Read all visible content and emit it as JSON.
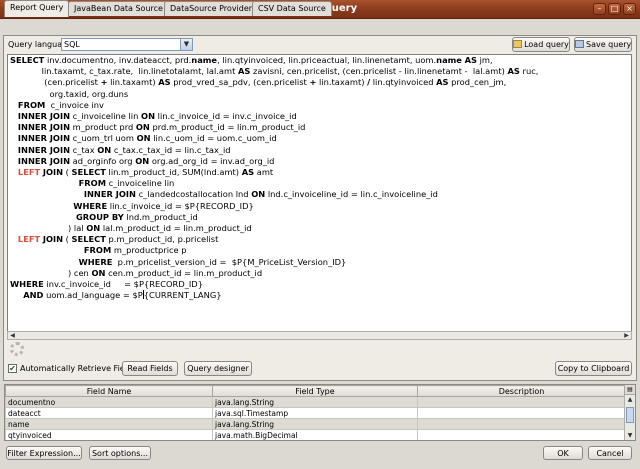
{
  "window": {
    "title": "Report query"
  },
  "tabs": [
    {
      "label": "Report Query",
      "active": true
    },
    {
      "label": "JavaBean Data Source",
      "active": false
    },
    {
      "label": "DataSource Provider",
      "active": false
    },
    {
      "label": "CSV Data Source",
      "active": false
    }
  ],
  "query": {
    "language_label": "Query language",
    "language_value": "SQL",
    "load_label": "Load query",
    "save_label": "Save query"
  },
  "sql_lines": [
    [
      [
        "k",
        "SELECT"
      ],
      [
        "t",
        " inv.documentno, inv.dateacct, prd."
      ],
      [
        "k",
        "name"
      ],
      [
        "t",
        ", lin.qtyinvoiced, lin.priceactual, lin.linenetamt, uom."
      ],
      [
        "k",
        "name"
      ],
      [
        "t",
        " "
      ],
      [
        "k",
        "AS"
      ],
      [
        "t",
        " jm,"
      ]
    ],
    [
      [
        "t",
        "            lin.taxamt, c_tax.rate,  lin.linetotalamt, lal.amt "
      ],
      [
        "k",
        "AS"
      ],
      [
        "t",
        " zavisni, cen.pricelist, (cen.pricelist - lin.linenetamt -  lal.amt) "
      ],
      [
        "k",
        "AS"
      ],
      [
        "t",
        " ruc,"
      ]
    ],
    [
      [
        "t",
        "             (cen.pricelist "
      ],
      [
        "k",
        "+"
      ],
      [
        "t",
        " lin.taxamt) "
      ],
      [
        "k",
        "AS"
      ],
      [
        "t",
        " prod_vred_sa_pdv, (cen.pricelist "
      ],
      [
        "k",
        "+"
      ],
      [
        "t",
        " lin.taxamt) "
      ],
      [
        "k",
        "/"
      ],
      [
        "t",
        " lin.qtyinvoiced "
      ],
      [
        "k",
        "AS"
      ],
      [
        "t",
        " prod_cen_jm,"
      ]
    ],
    [
      [
        "t",
        "               org.taxid, org.duns"
      ]
    ],
    [
      [
        "t",
        "   "
      ],
      [
        "k",
        "FROM"
      ],
      [
        "t",
        "  c_invoice inv"
      ]
    ],
    [
      [
        "t",
        "   "
      ],
      [
        "k",
        "INNER JOIN"
      ],
      [
        "t",
        " c_invoiceline lin "
      ],
      [
        "k",
        "ON"
      ],
      [
        "t",
        " lin.c_invoice_id = inv.c_invoice_id"
      ]
    ],
    [
      [
        "t",
        "   "
      ],
      [
        "k",
        "INNER JOIN"
      ],
      [
        "t",
        " m_product prd "
      ],
      [
        "k",
        "ON"
      ],
      [
        "t",
        " prd.m_product_id = lin.m_product_id"
      ]
    ],
    [
      [
        "t",
        "   "
      ],
      [
        "k",
        "INNER JOIN"
      ],
      [
        "t",
        " c_uom_trl uom "
      ],
      [
        "k",
        "ON"
      ],
      [
        "t",
        " lin.c_uom_id = uom.c_uom_id"
      ]
    ],
    [
      [
        "t",
        "   "
      ],
      [
        "k",
        "INNER JOIN"
      ],
      [
        "t",
        " c_tax "
      ],
      [
        "k",
        "ON"
      ],
      [
        "t",
        " c_tax.c_tax_id = lin.c_tax_id"
      ]
    ],
    [
      [
        "t",
        "   "
      ],
      [
        "k",
        "INNER JOIN"
      ],
      [
        "t",
        " ad_orginfo org "
      ],
      [
        "k",
        "ON"
      ],
      [
        "t",
        " org.ad_org_id = inv.ad_org_id"
      ]
    ],
    [
      [
        "t",
        "   "
      ],
      [
        "l",
        "LEFT"
      ],
      [
        "t",
        " "
      ],
      [
        "k",
        "JOIN"
      ],
      [
        "t",
        " ( "
      ],
      [
        "k",
        "SELECT"
      ],
      [
        "t",
        " lin.m_product_id, SUM(lnd.amt) "
      ],
      [
        "k",
        "AS"
      ],
      [
        "t",
        " amt"
      ]
    ],
    [
      [
        "t",
        "                          "
      ],
      [
        "k",
        "FROM"
      ],
      [
        "t",
        " c_invoiceline lin"
      ]
    ],
    [
      [
        "t",
        "                            "
      ],
      [
        "k",
        "INNER JOIN"
      ],
      [
        "t",
        " c_landedcostallocation lnd "
      ],
      [
        "k",
        "ON"
      ],
      [
        "t",
        " lnd.c_invoiceline_id = lin.c_invoiceline_id"
      ]
    ],
    [
      [
        "t",
        "                        "
      ],
      [
        "k",
        "WHERE"
      ],
      [
        "t",
        " lin.c_invoice_id = $P{RECORD_ID}"
      ]
    ],
    [
      [
        "t",
        "                         "
      ],
      [
        "k",
        "GROUP BY"
      ],
      [
        "t",
        " lnd.m_product_id"
      ]
    ],
    [
      [
        "t",
        "                      ) lal "
      ],
      [
        "k",
        "ON"
      ],
      [
        "t",
        " lal.m_product_id = lin.m_product_id"
      ]
    ],
    [
      [
        "t",
        "   "
      ],
      [
        "l",
        "LEFT"
      ],
      [
        "t",
        " "
      ],
      [
        "k",
        "JOIN"
      ],
      [
        "t",
        " ( "
      ],
      [
        "k",
        "SELECT"
      ],
      [
        "t",
        " p.m_product_id, p.pricelist"
      ]
    ],
    [
      [
        "t",
        "                            "
      ],
      [
        "k",
        "FROM"
      ],
      [
        "t",
        " m_productprice p"
      ]
    ],
    [
      [
        "t",
        "                          "
      ],
      [
        "k",
        "WHERE"
      ],
      [
        "t",
        "  p.m_pricelist_version_id =  $P{M_PriceList_Version_ID}"
      ]
    ],
    [
      [
        "t",
        "                      ) cen "
      ],
      [
        "k",
        "ON"
      ],
      [
        "t",
        " cen.m_product_id = lin.m_product_id"
      ]
    ],
    [
      [
        "k",
        "WHERE"
      ],
      [
        "t",
        " inv.c_invoice_id     = $P{RECORD_ID}"
      ]
    ],
    [
      [
        "t",
        "     "
      ],
      [
        "k",
        "AND"
      ],
      [
        "t",
        " uom.ad_language = $P"
      ],
      [
        "c",
        ""
      ],
      [
        "t",
        "{CURRENT_LANG}"
      ]
    ]
  ],
  "options": {
    "auto_retrieve_label": "Automatically Retrieve Fields",
    "auto_retrieve_checked": true,
    "read_fields_label": "Read Fields",
    "query_designer_label": "Query designer",
    "copy_label": "Copy to Clipboard"
  },
  "fields_table": {
    "headers": [
      "Field Name",
      "Field Type",
      "Description"
    ],
    "rows": [
      [
        "documentno",
        "java.lang.String",
        ""
      ],
      [
        "dateacct",
        "java.sql.Timestamp",
        ""
      ],
      [
        "name",
        "java.lang.String",
        ""
      ],
      [
        "qtyinvoiced",
        "java.math.BigDecimal",
        ""
      ]
    ]
  },
  "footer": {
    "filter_label": "Filter Expression...",
    "sort_label": "Sort options...",
    "ok_label": "OK",
    "cancel_label": "Cancel"
  }
}
